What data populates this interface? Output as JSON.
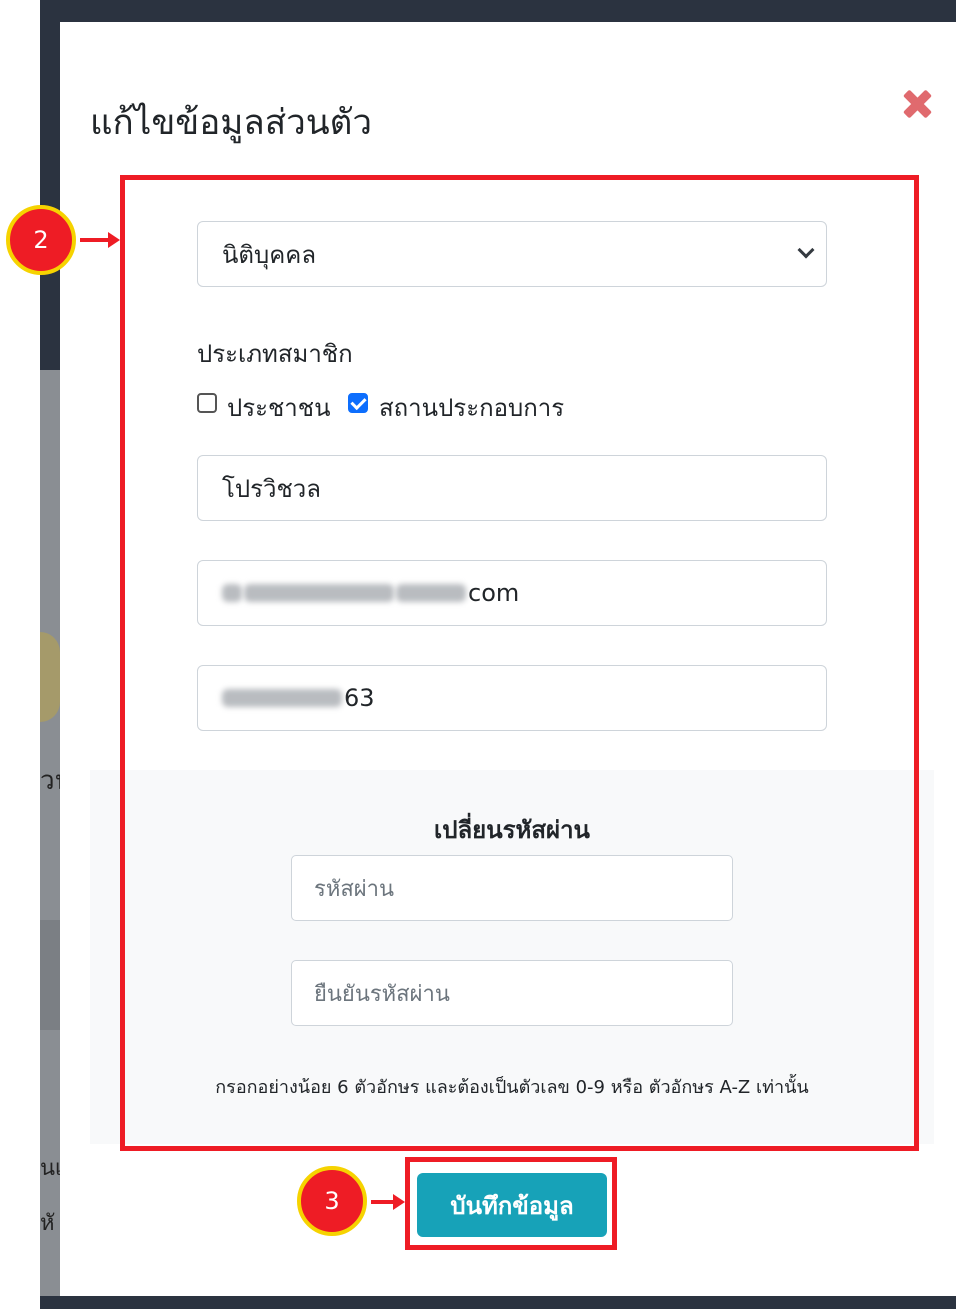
{
  "background": {
    "peek_text_1": "วน",
    "peek_text_2": "นเ",
    "peek_text_3": "หั"
  },
  "modal": {
    "title": "แก้ไขข้อมูลส่วนตัว",
    "close_icon": "close-x-icon"
  },
  "form": {
    "entity_select": {
      "selected": "นิติบุคคล"
    },
    "member_type_label": "ประเภทสมาชิก",
    "member_types": [
      {
        "label": "ประชาชน",
        "checked": false
      },
      {
        "label": "สถานประกอบการ",
        "checked": true
      }
    ],
    "name_value": "โปรวิชวล",
    "email_value_suffix": "com",
    "phone_value_suffix": "63"
  },
  "password": {
    "title": "เปลี่ยนรหัสผ่าน",
    "password_placeholder": "รหัสผ่าน",
    "confirm_placeholder": "ยืนยันรหัสผ่าน",
    "hint": "กรอกอย่างน้อย 6 ตัวอักษร และต้องเป็นตัวเลข 0-9 หรือ ตัวอักษร A-Z เท่านั้น"
  },
  "save_button": {
    "label": "บันทึกข้อมูล"
  },
  "annotations": {
    "step_form": "2",
    "step_save": "3",
    "highlight_color": "#ee1c25",
    "badge_border_color": "#f6d300"
  },
  "colors": {
    "button_primary": "#17a2b8",
    "checkbox_checked": "#0d6efd",
    "close_icon": "#e06a6e"
  }
}
